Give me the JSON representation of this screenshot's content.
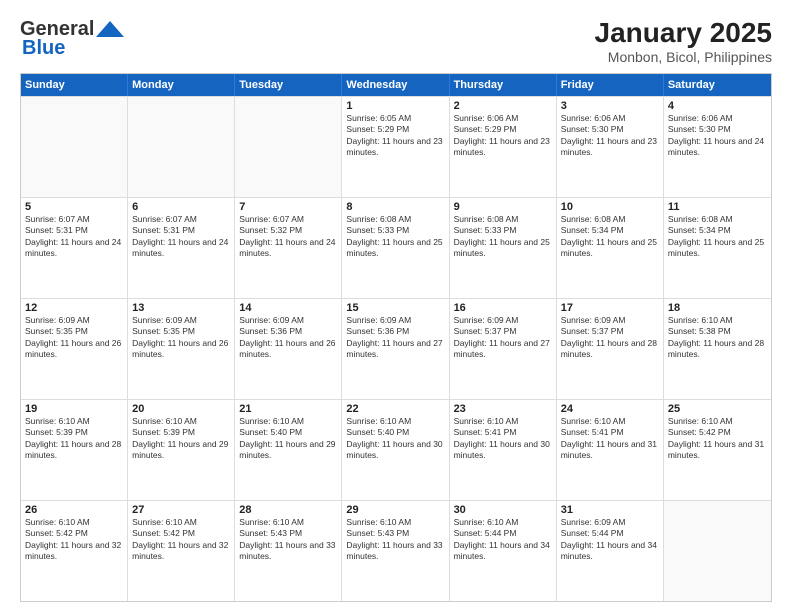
{
  "logo": {
    "general": "General",
    "blue": "Blue"
  },
  "header": {
    "title": "January 2025",
    "subtitle": "Monbon, Bicol, Philippines"
  },
  "weekdays": [
    "Sunday",
    "Monday",
    "Tuesday",
    "Wednesday",
    "Thursday",
    "Friday",
    "Saturday"
  ],
  "weeks": [
    [
      {
        "day": "",
        "sunrise": "",
        "sunset": "",
        "daylight": ""
      },
      {
        "day": "",
        "sunrise": "",
        "sunset": "",
        "daylight": ""
      },
      {
        "day": "",
        "sunrise": "",
        "sunset": "",
        "daylight": ""
      },
      {
        "day": "1",
        "sunrise": "Sunrise: 6:05 AM",
        "sunset": "Sunset: 5:29 PM",
        "daylight": "Daylight: 11 hours and 23 minutes."
      },
      {
        "day": "2",
        "sunrise": "Sunrise: 6:06 AM",
        "sunset": "Sunset: 5:29 PM",
        "daylight": "Daylight: 11 hours and 23 minutes."
      },
      {
        "day": "3",
        "sunrise": "Sunrise: 6:06 AM",
        "sunset": "Sunset: 5:30 PM",
        "daylight": "Daylight: 11 hours and 23 minutes."
      },
      {
        "day": "4",
        "sunrise": "Sunrise: 6:06 AM",
        "sunset": "Sunset: 5:30 PM",
        "daylight": "Daylight: 11 hours and 24 minutes."
      }
    ],
    [
      {
        "day": "5",
        "sunrise": "Sunrise: 6:07 AM",
        "sunset": "Sunset: 5:31 PM",
        "daylight": "Daylight: 11 hours and 24 minutes."
      },
      {
        "day": "6",
        "sunrise": "Sunrise: 6:07 AM",
        "sunset": "Sunset: 5:31 PM",
        "daylight": "Daylight: 11 hours and 24 minutes."
      },
      {
        "day": "7",
        "sunrise": "Sunrise: 6:07 AM",
        "sunset": "Sunset: 5:32 PM",
        "daylight": "Daylight: 11 hours and 24 minutes."
      },
      {
        "day": "8",
        "sunrise": "Sunrise: 6:08 AM",
        "sunset": "Sunset: 5:33 PM",
        "daylight": "Daylight: 11 hours and 25 minutes."
      },
      {
        "day": "9",
        "sunrise": "Sunrise: 6:08 AM",
        "sunset": "Sunset: 5:33 PM",
        "daylight": "Daylight: 11 hours and 25 minutes."
      },
      {
        "day": "10",
        "sunrise": "Sunrise: 6:08 AM",
        "sunset": "Sunset: 5:34 PM",
        "daylight": "Daylight: 11 hours and 25 minutes."
      },
      {
        "day": "11",
        "sunrise": "Sunrise: 6:08 AM",
        "sunset": "Sunset: 5:34 PM",
        "daylight": "Daylight: 11 hours and 25 minutes."
      }
    ],
    [
      {
        "day": "12",
        "sunrise": "Sunrise: 6:09 AM",
        "sunset": "Sunset: 5:35 PM",
        "daylight": "Daylight: 11 hours and 26 minutes."
      },
      {
        "day": "13",
        "sunrise": "Sunrise: 6:09 AM",
        "sunset": "Sunset: 5:35 PM",
        "daylight": "Daylight: 11 hours and 26 minutes."
      },
      {
        "day": "14",
        "sunrise": "Sunrise: 6:09 AM",
        "sunset": "Sunset: 5:36 PM",
        "daylight": "Daylight: 11 hours and 26 minutes."
      },
      {
        "day": "15",
        "sunrise": "Sunrise: 6:09 AM",
        "sunset": "Sunset: 5:36 PM",
        "daylight": "Daylight: 11 hours and 27 minutes."
      },
      {
        "day": "16",
        "sunrise": "Sunrise: 6:09 AM",
        "sunset": "Sunset: 5:37 PM",
        "daylight": "Daylight: 11 hours and 27 minutes."
      },
      {
        "day": "17",
        "sunrise": "Sunrise: 6:09 AM",
        "sunset": "Sunset: 5:37 PM",
        "daylight": "Daylight: 11 hours and 28 minutes."
      },
      {
        "day": "18",
        "sunrise": "Sunrise: 6:10 AM",
        "sunset": "Sunset: 5:38 PM",
        "daylight": "Daylight: 11 hours and 28 minutes."
      }
    ],
    [
      {
        "day": "19",
        "sunrise": "Sunrise: 6:10 AM",
        "sunset": "Sunset: 5:39 PM",
        "daylight": "Daylight: 11 hours and 28 minutes."
      },
      {
        "day": "20",
        "sunrise": "Sunrise: 6:10 AM",
        "sunset": "Sunset: 5:39 PM",
        "daylight": "Daylight: 11 hours and 29 minutes."
      },
      {
        "day": "21",
        "sunrise": "Sunrise: 6:10 AM",
        "sunset": "Sunset: 5:40 PM",
        "daylight": "Daylight: 11 hours and 29 minutes."
      },
      {
        "day": "22",
        "sunrise": "Sunrise: 6:10 AM",
        "sunset": "Sunset: 5:40 PM",
        "daylight": "Daylight: 11 hours and 30 minutes."
      },
      {
        "day": "23",
        "sunrise": "Sunrise: 6:10 AM",
        "sunset": "Sunset: 5:41 PM",
        "daylight": "Daylight: 11 hours and 30 minutes."
      },
      {
        "day": "24",
        "sunrise": "Sunrise: 6:10 AM",
        "sunset": "Sunset: 5:41 PM",
        "daylight": "Daylight: 11 hours and 31 minutes."
      },
      {
        "day": "25",
        "sunrise": "Sunrise: 6:10 AM",
        "sunset": "Sunset: 5:42 PM",
        "daylight": "Daylight: 11 hours and 31 minutes."
      }
    ],
    [
      {
        "day": "26",
        "sunrise": "Sunrise: 6:10 AM",
        "sunset": "Sunset: 5:42 PM",
        "daylight": "Daylight: 11 hours and 32 minutes."
      },
      {
        "day": "27",
        "sunrise": "Sunrise: 6:10 AM",
        "sunset": "Sunset: 5:42 PM",
        "daylight": "Daylight: 11 hours and 32 minutes."
      },
      {
        "day": "28",
        "sunrise": "Sunrise: 6:10 AM",
        "sunset": "Sunset: 5:43 PM",
        "daylight": "Daylight: 11 hours and 33 minutes."
      },
      {
        "day": "29",
        "sunrise": "Sunrise: 6:10 AM",
        "sunset": "Sunset: 5:43 PM",
        "daylight": "Daylight: 11 hours and 33 minutes."
      },
      {
        "day": "30",
        "sunrise": "Sunrise: 6:10 AM",
        "sunset": "Sunset: 5:44 PM",
        "daylight": "Daylight: 11 hours and 34 minutes."
      },
      {
        "day": "31",
        "sunrise": "Sunrise: 6:09 AM",
        "sunset": "Sunset: 5:44 PM",
        "daylight": "Daylight: 11 hours and 34 minutes."
      },
      {
        "day": "",
        "sunrise": "",
        "sunset": "",
        "daylight": ""
      }
    ]
  ]
}
